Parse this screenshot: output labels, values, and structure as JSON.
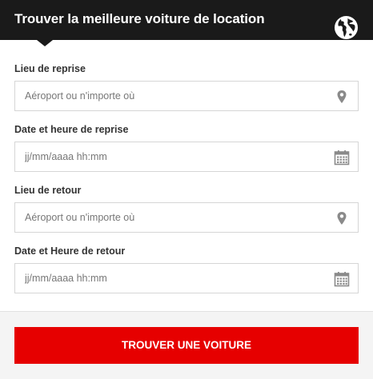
{
  "header": {
    "title": "Trouver la meilleure voiture de location",
    "icon": "globe-icon"
  },
  "form": {
    "pickup_location": {
      "label": "Lieu de reprise",
      "placeholder": "Aéroport ou n'importe où",
      "icon": "location-pin-icon"
    },
    "pickup_datetime": {
      "label": "Date et heure de reprise",
      "placeholder": "jj/mm/aaaa hh:mm",
      "icon": "calendar-icon"
    },
    "return_location": {
      "label": "Lieu de retour",
      "placeholder": "Aéroport ou n'importe où",
      "icon": "location-pin-icon"
    },
    "return_datetime": {
      "label": "Date et Heure de retour",
      "placeholder": "jj/mm/aaaa hh:mm",
      "icon": "calendar-icon"
    },
    "submit_label": "TROUVER UNE VOITURE"
  },
  "colors": {
    "header_bg": "#1a1a1a",
    "accent": "#e60000",
    "icon_gray": "#8a8a8a"
  }
}
